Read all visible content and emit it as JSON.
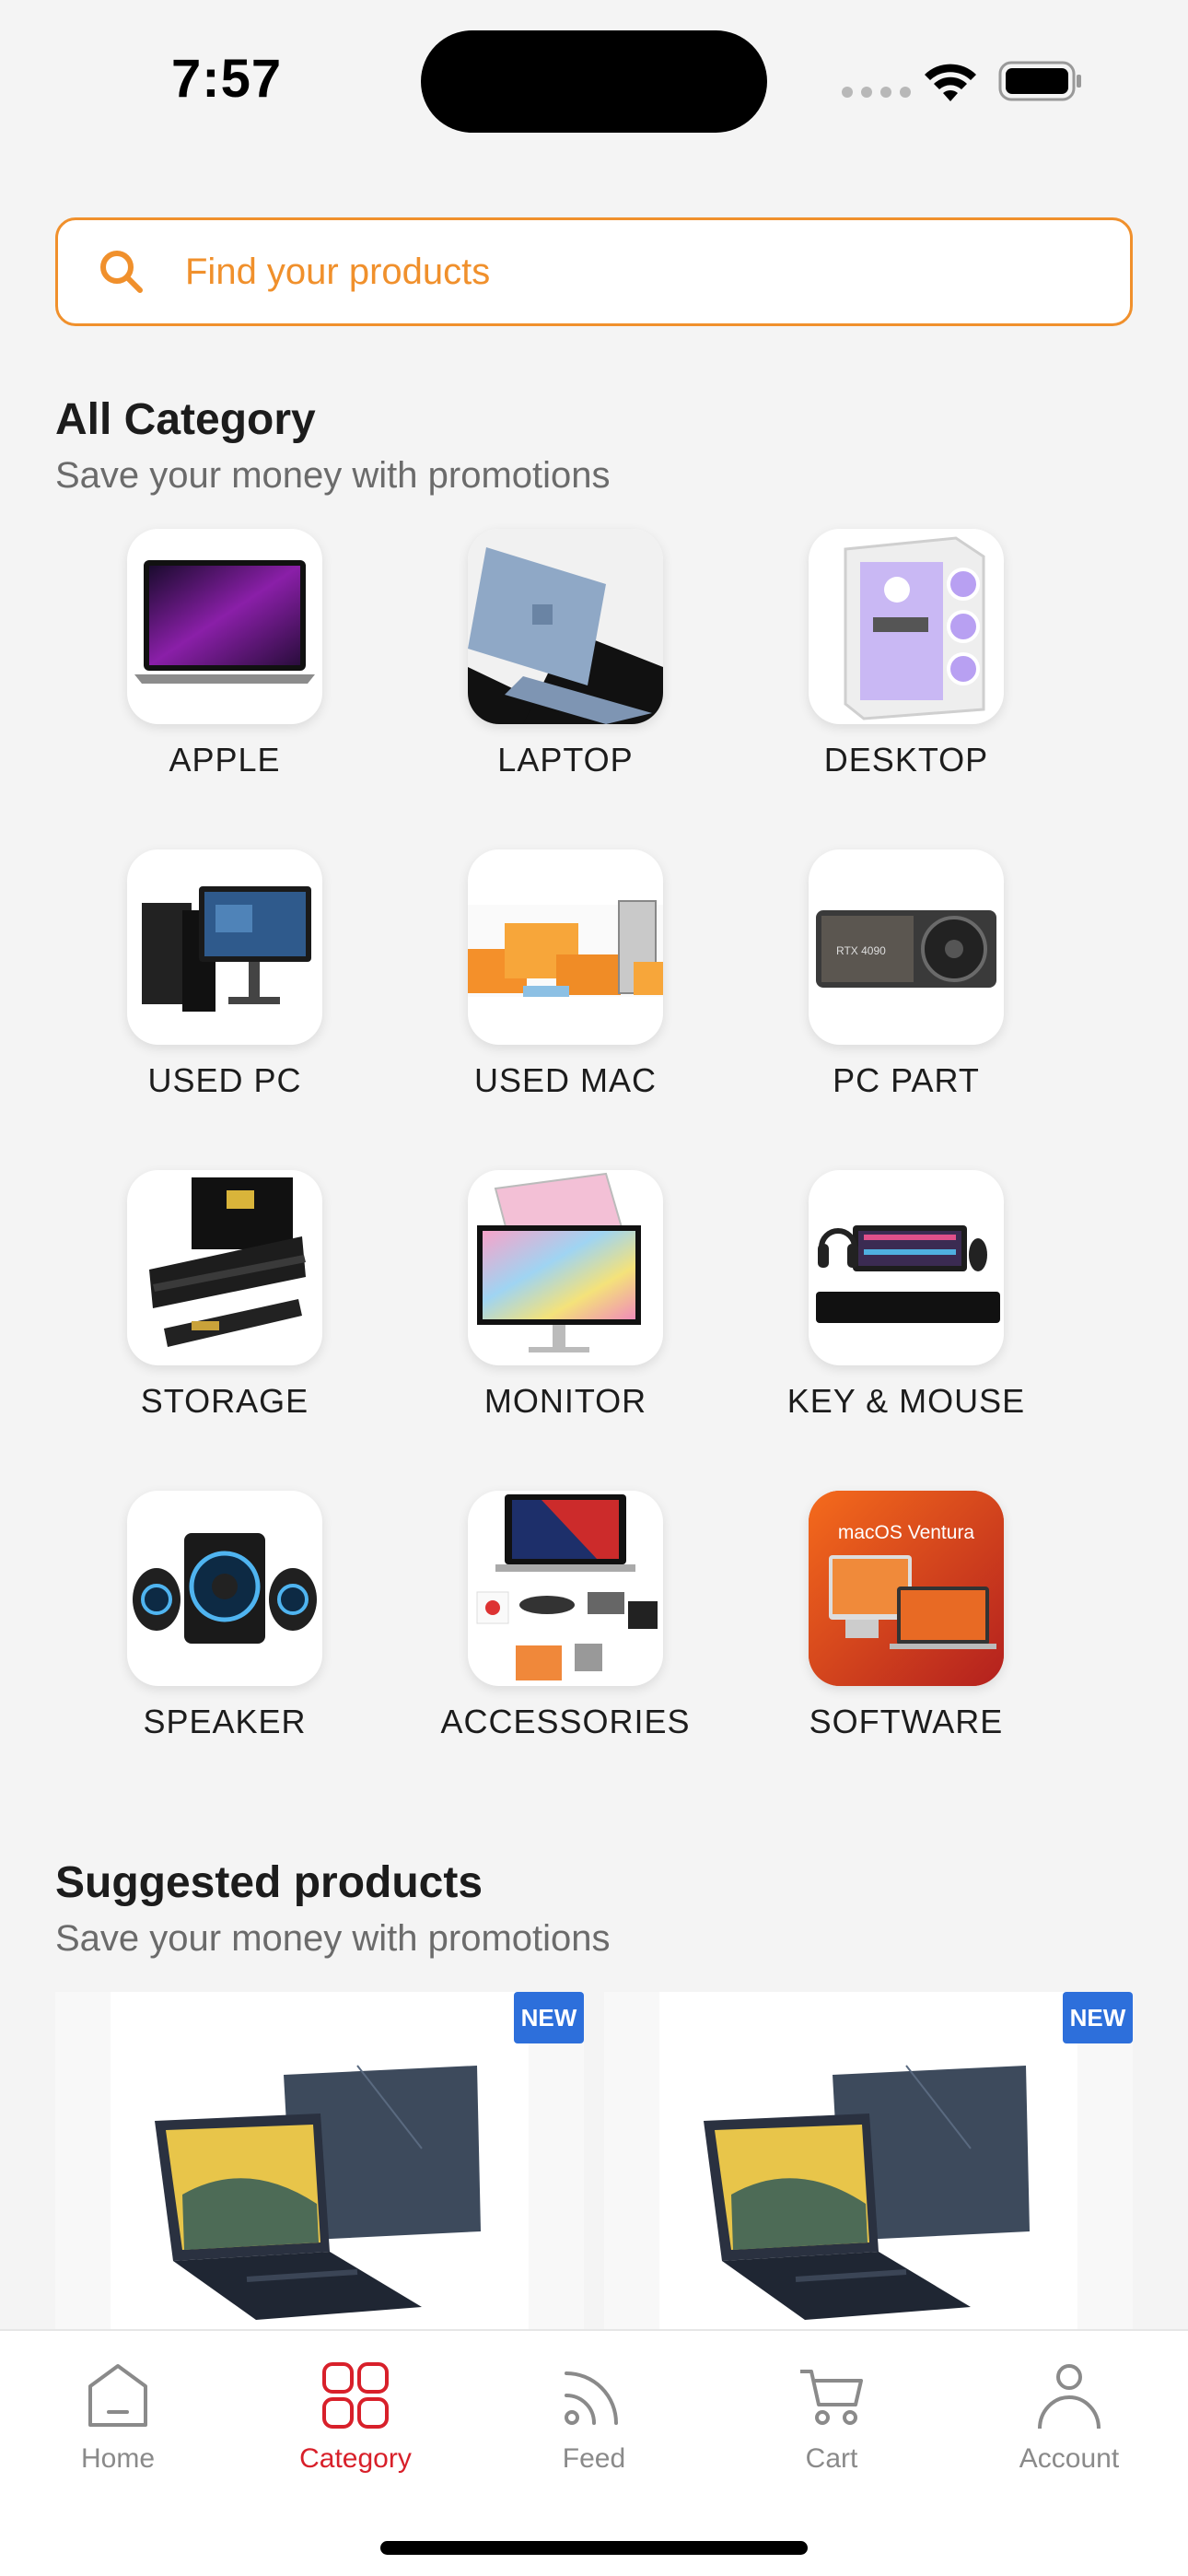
{
  "status": {
    "time": "7:57"
  },
  "search": {
    "placeholder": "Find your products"
  },
  "categories_section": {
    "title": "All Category",
    "subtitle": "Save your money with promotions",
    "items": [
      {
        "label": "APPLE",
        "icon": "macbook-icon"
      },
      {
        "label": "LAPTOP",
        "icon": "laptop-icon"
      },
      {
        "label": "DESKTOP",
        "icon": "pc-case-icon"
      },
      {
        "label": "USED PC",
        "icon": "used-pc-icon"
      },
      {
        "label": "USED MAC",
        "icon": "used-mac-icon"
      },
      {
        "label": "PC PART",
        "icon": "gpu-icon"
      },
      {
        "label": "STORAGE",
        "icon": "ssd-icon"
      },
      {
        "label": "MONITOR",
        "icon": "monitor-icon"
      },
      {
        "label": "KEY & MOUSE",
        "icon": "keyboard-mouse-icon"
      },
      {
        "label": "SPEAKER",
        "icon": "speaker-icon"
      },
      {
        "label": "ACCESSORIES",
        "icon": "accessories-icon"
      },
      {
        "label": "SOFTWARE",
        "icon": "software-icon"
      }
    ],
    "software_tile_text": "macOS Ventura"
  },
  "suggested_section": {
    "title": "Suggested products",
    "subtitle": "Save your money with promotions",
    "products": [
      {
        "badge": "NEW"
      },
      {
        "badge": "NEW"
      }
    ]
  },
  "tab_bar": {
    "tabs": [
      {
        "label": "Home",
        "icon": "home-icon"
      },
      {
        "label": "Category",
        "icon": "category-grid-icon",
        "active": true
      },
      {
        "label": "Feed",
        "icon": "feed-icon"
      },
      {
        "label": "Cart",
        "icon": "cart-icon"
      },
      {
        "label": "Account",
        "icon": "account-icon"
      }
    ]
  },
  "colors": {
    "accent": "#f0902c",
    "active_tab": "#d8202a",
    "badge": "#2d6fdb",
    "background": "#f4f4f4"
  }
}
